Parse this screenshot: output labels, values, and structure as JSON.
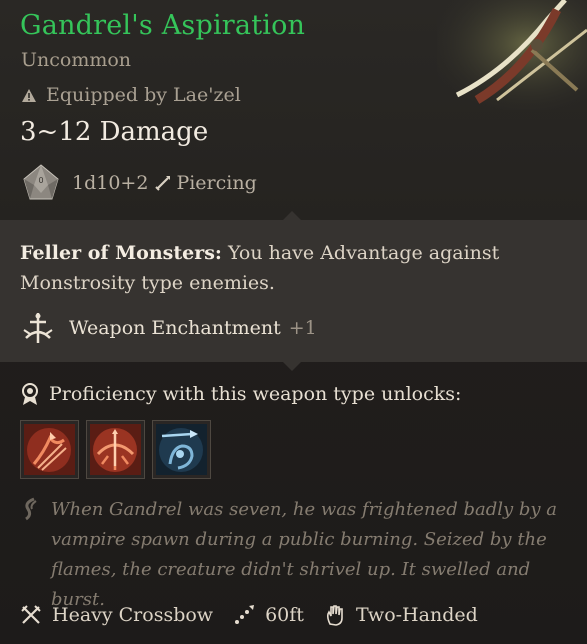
{
  "item": {
    "name": "Gandrel's Aspiration",
    "rarity": "Uncommon",
    "equipped_by": "Equipped by Lae'zel",
    "damage": "3~12 Damage",
    "damage_dice": "1d10+2",
    "damage_type": "Piercing"
  },
  "enchant_panel": {
    "passive_name": "Feller of Monsters:",
    "passive_text": "You have Advantage against Monstrosity type enemies.",
    "enchant_label": "Weapon Enchantment",
    "enchant_bonus": "+1"
  },
  "proficiency": {
    "label": "Proficiency with this weapon type unlocks:",
    "actions": [
      {
        "icon": "piercing-shot-icon"
      },
      {
        "icon": "brace-ranged-icon"
      },
      {
        "icon": "mobile-shot-icon"
      }
    ]
  },
  "lore": "When Gandrel was seven, he was frightened badly by a vampire spawn during a public burning. Seized by the flames, the creature didn't shrivel up. It swelled and burst.",
  "footer": {
    "weapon_type": "Heavy Crossbow",
    "range": "60ft",
    "handedness": "Two-Handed"
  },
  "colors": {
    "title_green": "#35c55a",
    "panel_bg": "#363330",
    "action_red": "#b8402c",
    "action_blue": "#3a6f8f"
  }
}
